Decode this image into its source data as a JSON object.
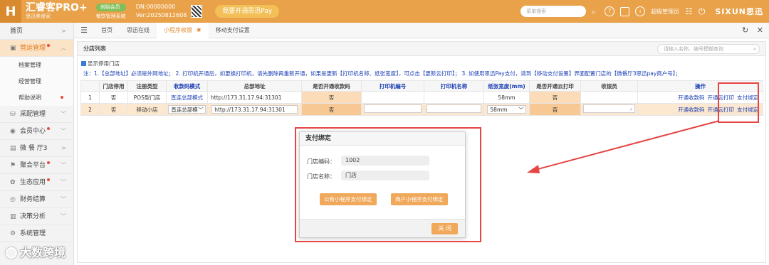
{
  "header": {
    "brand_name": "汇睿客PRO+",
    "brand_sub": "思迅美食家",
    "badge_label": "创始会员",
    "badge_sub": "餐饮管理系统",
    "dn": "DN:00000000",
    "version": "Ver:20250812608",
    "pay_button": "我要开通思迅Pay",
    "menu_search_placeholder": "菜单搜索",
    "user": "超级管理员",
    "brand_right": "SIXUN思迅"
  },
  "sidebar": {
    "items": [
      {
        "label": "首页"
      },
      {
        "label": "营运管理"
      },
      {
        "label": "档案管理"
      },
      {
        "label": "经营管理"
      },
      {
        "label": "帮助说明"
      },
      {
        "label": "采配管理"
      },
      {
        "label": "会员中心"
      },
      {
        "label": "微 餐 厅3"
      },
      {
        "label": "聚合平台"
      },
      {
        "label": "生态应用"
      },
      {
        "label": "财务结算"
      },
      {
        "label": "决策分析"
      },
      {
        "label": "系统管理"
      }
    ]
  },
  "tabs": [
    {
      "label": "首页"
    },
    {
      "label": "思迅在线"
    },
    {
      "label": "小程序收银"
    },
    {
      "label": "移动支付设置"
    }
  ],
  "panel": {
    "title": "分店列表",
    "search_placeholder": "请输入名称、编号模糊查询",
    "show_disabled_label": "显示停用门店",
    "note": "注：1.【总部地址】必须是外网地址；  2. 打印机开通后，如更换打印机，请先删除再重新开通，如果是更新【打印机名称、纸张宽度】，可点击【更新云打印】；  3. 如使用思迅Pay支付，请到【移动支付设置】界面配置门店的【微餐厅3思迅pay商户号】；"
  },
  "table": {
    "headers": [
      "",
      "门店停用",
      "注册类型",
      "收款码模式",
      "总部地址",
      "是否开通收款码",
      "打印机编号",
      "打印机名称",
      "纸张宽度(mm)",
      "是否开通云打印",
      "收银员",
      "操作"
    ],
    "rows": [
      {
        "no": "1",
        "disabled": "否",
        "reg_type": "POS型门店",
        "mode": "直连总部模式",
        "address": "http://173.31.17.94:31301",
        "qr_open": "否",
        "printer_no": "",
        "printer_name": "",
        "paper": "58mm",
        "cloud_print": "否",
        "cashier": "",
        "op1": "开通收款码",
        "op2": "开通云打印",
        "op3": "支付绑定"
      },
      {
        "no": "2",
        "disabled": "否",
        "reg_type": "移动小店",
        "mode": "直连总部模",
        "address": "http://173.31.17.94:31301",
        "qr_open": "否",
        "printer_no": "",
        "printer_name": "",
        "paper": "58mm",
        "cloud_print": "否",
        "cashier": "",
        "op1": "开通收款码",
        "op2": "开通云打印",
        "op3": "支付绑定"
      }
    ]
  },
  "modal": {
    "title": "支付绑定",
    "code_label": "门店编码：",
    "code_value": "1002",
    "name_label": "门店名称：",
    "name_value": "门店",
    "btn_public": "公有小程序支付绑定",
    "btn_merchant": "商户小程序支付绑定",
    "btn_close": "关 闭"
  },
  "watermark": "大数跨境",
  "colors": {
    "header": "#e9a24a",
    "accent": "#f0a85a",
    "link": "#1a3fb5",
    "annotation": "#e64545"
  }
}
